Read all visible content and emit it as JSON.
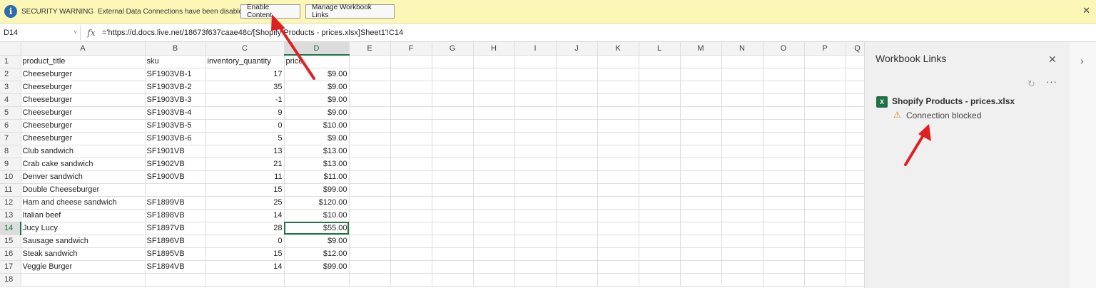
{
  "security_bar": {
    "title": "SECURITY WARNING",
    "message": "External Data Connections have been disabled",
    "enable_label": "Enable Content",
    "manage_label": "Manage Workbook Links",
    "close": "✕"
  },
  "formula_bar": {
    "cell_ref": "D14",
    "fx": "fx",
    "formula": "='https://d.docs.live.net/18673f637caae48c/[Shopify Products - prices.xlsx]Sheet1'!C14"
  },
  "columns": [
    "A",
    "B",
    "C",
    "D",
    "E",
    "F",
    "G",
    "H",
    "I",
    "J",
    "K",
    "L",
    "M",
    "N",
    "O",
    "P",
    "Q"
  ],
  "active_column": "D",
  "active_row": "14",
  "rows": [
    {
      "n": "1",
      "a": "product_title",
      "b": "sku",
      "c": "inventory_quantity",
      "d": "price"
    },
    {
      "n": "2",
      "a": "Cheeseburger",
      "b": "SF1903VB-1",
      "c": "17",
      "d": "$9.00"
    },
    {
      "n": "3",
      "a": "Cheeseburger",
      "b": "SF1903VB-2",
      "c": "35",
      "d": "$9.00"
    },
    {
      "n": "4",
      "a": "Cheeseburger",
      "b": "SF1903VB-3",
      "c": "-1",
      "d": "$9.00"
    },
    {
      "n": "5",
      "a": "Cheeseburger",
      "b": "SF1903VB-4",
      "c": "9",
      "d": "$9.00"
    },
    {
      "n": "6",
      "a": "Cheeseburger",
      "b": "SF1903VB-5",
      "c": "0",
      "d": "$10.00"
    },
    {
      "n": "7",
      "a": "Cheeseburger",
      "b": "SF1903VB-6",
      "c": "5",
      "d": "$9.00"
    },
    {
      "n": "8",
      "a": "Club sandwich",
      "b": "SF1901VB",
      "c": "13",
      "d": "$13.00"
    },
    {
      "n": "9",
      "a": "Crab cake sandwich",
      "b": "SF1902VB",
      "c": "21",
      "d": "$13.00"
    },
    {
      "n": "10",
      "a": "Denver sandwich",
      "b": "SF1900VB",
      "c": "11",
      "d": "$11.00"
    },
    {
      "n": "11",
      "a": "Double Cheeseburger",
      "b": "",
      "c": "15",
      "d": "$99.00"
    },
    {
      "n": "12",
      "a": "Ham and cheese sandwich",
      "b": "SF1899VB",
      "c": "25",
      "d": "$120.00"
    },
    {
      "n": "13",
      "a": "Italian beef",
      "b": "SF1898VB",
      "c": "14",
      "d": "$10.00"
    },
    {
      "n": "14",
      "a": "Jucy Lucy",
      "b": "SF1897VB",
      "c": "28",
      "d": "$55.00"
    },
    {
      "n": "15",
      "a": "Sausage sandwich",
      "b": "SF1896VB",
      "c": "0",
      "d": "$9.00"
    },
    {
      "n": "16",
      "a": "Steak sandwich",
      "b": "SF1895VB",
      "c": "15",
      "d": "$12.00"
    },
    {
      "n": "17",
      "a": "Veggie Burger",
      "b": "SF1894VB",
      "c": "14",
      "d": "$99.00"
    },
    {
      "n": "18",
      "a": "",
      "b": "",
      "c": "",
      "d": ""
    }
  ],
  "pane": {
    "title": "Workbook Links",
    "close": "✕",
    "more": "···",
    "file_name": "Shopify Products - prices.xlsx",
    "status": "Connection blocked",
    "excel_icon_letter": "X"
  },
  "colors": {
    "accent": "#217346",
    "warning_bar": "#fcf7b6",
    "arrow": "#e02020"
  }
}
